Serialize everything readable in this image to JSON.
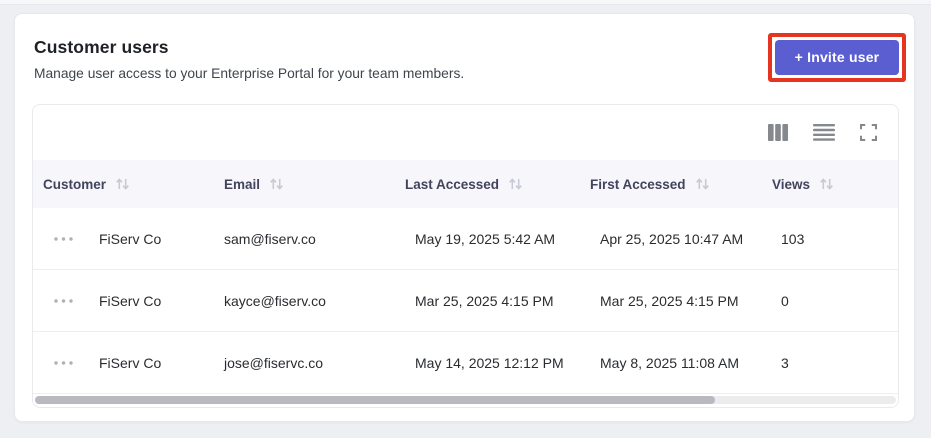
{
  "page": {
    "title": "Customer users",
    "subtitle": "Manage user access to your Enterprise Portal for your team members.",
    "invite_button_label": "+ Invite user"
  },
  "toolbar": {
    "icons": [
      "columns-icon",
      "density-icon",
      "fullscreen-icon"
    ]
  },
  "table": {
    "columns": [
      {
        "label": "Customer",
        "sort_icon": "sort-arrows-icon"
      },
      {
        "label": "Email",
        "sort_icon": "sort-arrows-icon"
      },
      {
        "label": "Last Accessed",
        "sort_icon": "sort-arrows-icon"
      },
      {
        "label": "First Accessed",
        "sort_icon": "sort-arrows-icon"
      },
      {
        "label": "Views",
        "sort_icon": "sort-arrows-icon"
      }
    ],
    "rows": [
      {
        "menu_icon": "ellipsis-icon",
        "customer": "FiServ Co",
        "email": "sam@fiserv.co",
        "last_accessed": "May 19, 2025 5:42 AM",
        "first_accessed": "Apr 25, 2025 10:47 AM",
        "views": "103"
      },
      {
        "menu_icon": "ellipsis-icon",
        "customer": "FiServ Co",
        "email": "kayce@fiserv.co",
        "last_accessed": "Mar 25, 2025 4:15 PM",
        "first_accessed": "Mar 25, 2025 4:15 PM",
        "views": "0"
      },
      {
        "menu_icon": "ellipsis-icon",
        "customer": "FiServ Co",
        "email": "jose@fiservc.co",
        "last_accessed": "May 14, 2025 12:12 PM",
        "first_accessed": "May 8, 2025 11:08 AM",
        "views": "3"
      }
    ]
  },
  "scrollbar": {
    "thumb_percent": 79
  },
  "colors": {
    "accent": "#5a5ed1",
    "annotation_red": "#e5341f",
    "header_bg": "#f7f7fb",
    "header_text": "#41445c"
  }
}
